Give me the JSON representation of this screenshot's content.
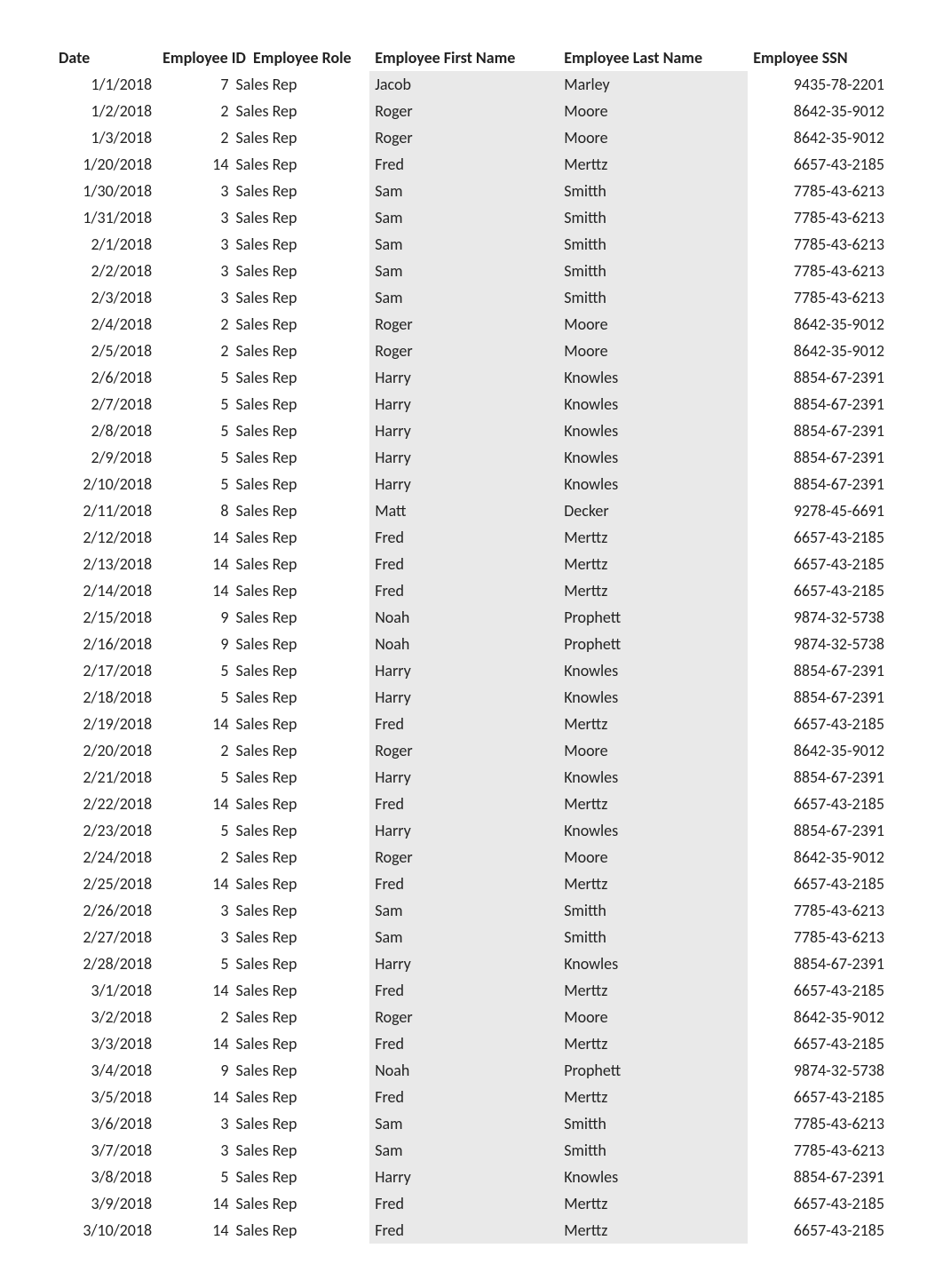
{
  "headers": {
    "date": "Date",
    "employee_id": "Employee ID",
    "employee_role": "Employee Role",
    "first_name": "Employee First Name",
    "last_name": "Employee Last Name",
    "ssn": "Employee SSN"
  },
  "rows": [
    {
      "date": "1/1/2018",
      "id": "7",
      "role": "Sales Rep",
      "first": "Jacob",
      "last": "Marley",
      "ssn": "9435-78-2201"
    },
    {
      "date": "1/2/2018",
      "id": "2",
      "role": "Sales Rep",
      "first": "Roger",
      "last": "Moore",
      "ssn": "8642-35-9012"
    },
    {
      "date": "1/3/2018",
      "id": "2",
      "role": "Sales Rep",
      "first": "Roger",
      "last": "Moore",
      "ssn": "8642-35-9012"
    },
    {
      "date": "1/20/2018",
      "id": "14",
      "role": "Sales Rep",
      "first": "Fred",
      "last": "Merttz",
      "ssn": "6657-43-2185"
    },
    {
      "date": "1/30/2018",
      "id": "3",
      "role": "Sales Rep",
      "first": "Sam",
      "last": "Smitth",
      "ssn": "7785-43-6213"
    },
    {
      "date": "1/31/2018",
      "id": "3",
      "role": "Sales Rep",
      "first": "Sam",
      "last": "Smitth",
      "ssn": "7785-43-6213"
    },
    {
      "date": "2/1/2018",
      "id": "3",
      "role": "Sales Rep",
      "first": "Sam",
      "last": "Smitth",
      "ssn": "7785-43-6213"
    },
    {
      "date": "2/2/2018",
      "id": "3",
      "role": "Sales Rep",
      "first": "Sam",
      "last": "Smitth",
      "ssn": "7785-43-6213"
    },
    {
      "date": "2/3/2018",
      "id": "3",
      "role": "Sales Rep",
      "first": "Sam",
      "last": "Smitth",
      "ssn": "7785-43-6213"
    },
    {
      "date": "2/4/2018",
      "id": "2",
      "role": "Sales Rep",
      "first": "Roger",
      "last": "Moore",
      "ssn": "8642-35-9012"
    },
    {
      "date": "2/5/2018",
      "id": "2",
      "role": "Sales Rep",
      "first": "Roger",
      "last": "Moore",
      "ssn": "8642-35-9012"
    },
    {
      "date": "2/6/2018",
      "id": "5",
      "role": "Sales Rep",
      "first": "Harry",
      "last": "Knowles",
      "ssn": "8854-67-2391"
    },
    {
      "date": "2/7/2018",
      "id": "5",
      "role": "Sales Rep",
      "first": "Harry",
      "last": "Knowles",
      "ssn": "8854-67-2391"
    },
    {
      "date": "2/8/2018",
      "id": "5",
      "role": "Sales Rep",
      "first": "Harry",
      "last": "Knowles",
      "ssn": "8854-67-2391"
    },
    {
      "date": "2/9/2018",
      "id": "5",
      "role": "Sales Rep",
      "first": "Harry",
      "last": "Knowles",
      "ssn": "8854-67-2391"
    },
    {
      "date": "2/10/2018",
      "id": "5",
      "role": "Sales Rep",
      "first": "Harry",
      "last": "Knowles",
      "ssn": "8854-67-2391"
    },
    {
      "date": "2/11/2018",
      "id": "8",
      "role": "Sales Rep",
      "first": "Matt",
      "last": "Decker",
      "ssn": "9278-45-6691"
    },
    {
      "date": "2/12/2018",
      "id": "14",
      "role": "Sales Rep",
      "first": "Fred",
      "last": "Merttz",
      "ssn": "6657-43-2185"
    },
    {
      "date": "2/13/2018",
      "id": "14",
      "role": "Sales Rep",
      "first": "Fred",
      "last": "Merttz",
      "ssn": "6657-43-2185"
    },
    {
      "date": "2/14/2018",
      "id": "14",
      "role": "Sales Rep",
      "first": "Fred",
      "last": "Merttz",
      "ssn": "6657-43-2185"
    },
    {
      "date": "2/15/2018",
      "id": "9",
      "role": "Sales Rep",
      "first": "Noah",
      "last": "Prophett",
      "ssn": "9874-32-5738"
    },
    {
      "date": "2/16/2018",
      "id": "9",
      "role": "Sales Rep",
      "first": "Noah",
      "last": "Prophett",
      "ssn": "9874-32-5738"
    },
    {
      "date": "2/17/2018",
      "id": "5",
      "role": "Sales Rep",
      "first": "Harry",
      "last": "Knowles",
      "ssn": "8854-67-2391"
    },
    {
      "date": "2/18/2018",
      "id": "5",
      "role": "Sales Rep",
      "first": "Harry",
      "last": "Knowles",
      "ssn": "8854-67-2391"
    },
    {
      "date": "2/19/2018",
      "id": "14",
      "role": "Sales Rep",
      "first": "Fred",
      "last": "Merttz",
      "ssn": "6657-43-2185"
    },
    {
      "date": "2/20/2018",
      "id": "2",
      "role": "Sales Rep",
      "first": "Roger",
      "last": "Moore",
      "ssn": "8642-35-9012"
    },
    {
      "date": "2/21/2018",
      "id": "5",
      "role": "Sales Rep",
      "first": "Harry",
      "last": "Knowles",
      "ssn": "8854-67-2391"
    },
    {
      "date": "2/22/2018",
      "id": "14",
      "role": "Sales Rep",
      "first": "Fred",
      "last": "Merttz",
      "ssn": "6657-43-2185"
    },
    {
      "date": "2/23/2018",
      "id": "5",
      "role": "Sales Rep",
      "first": "Harry",
      "last": "Knowles",
      "ssn": "8854-67-2391"
    },
    {
      "date": "2/24/2018",
      "id": "2",
      "role": "Sales Rep",
      "first": "Roger",
      "last": "Moore",
      "ssn": "8642-35-9012"
    },
    {
      "date": "2/25/2018",
      "id": "14",
      "role": "Sales Rep",
      "first": "Fred",
      "last": "Merttz",
      "ssn": "6657-43-2185"
    },
    {
      "date": "2/26/2018",
      "id": "3",
      "role": "Sales Rep",
      "first": "Sam",
      "last": "Smitth",
      "ssn": "7785-43-6213"
    },
    {
      "date": "2/27/2018",
      "id": "3",
      "role": "Sales Rep",
      "first": "Sam",
      "last": "Smitth",
      "ssn": "7785-43-6213"
    },
    {
      "date": "2/28/2018",
      "id": "5",
      "role": "Sales Rep",
      "first": "Harry",
      "last": "Knowles",
      "ssn": "8854-67-2391"
    },
    {
      "date": "3/1/2018",
      "id": "14",
      "role": "Sales Rep",
      "first": "Fred",
      "last": "Merttz",
      "ssn": "6657-43-2185"
    },
    {
      "date": "3/2/2018",
      "id": "2",
      "role": "Sales Rep",
      "first": "Roger",
      "last": "Moore",
      "ssn": "8642-35-9012"
    },
    {
      "date": "3/3/2018",
      "id": "14",
      "role": "Sales Rep",
      "first": "Fred",
      "last": "Merttz",
      "ssn": "6657-43-2185"
    },
    {
      "date": "3/4/2018",
      "id": "9",
      "role": "Sales Rep",
      "first": "Noah",
      "last": "Prophett",
      "ssn": "9874-32-5738"
    },
    {
      "date": "3/5/2018",
      "id": "14",
      "role": "Sales Rep",
      "first": "Fred",
      "last": "Merttz",
      "ssn": "6657-43-2185"
    },
    {
      "date": "3/6/2018",
      "id": "3",
      "role": "Sales Rep",
      "first": "Sam",
      "last": "Smitth",
      "ssn": "7785-43-6213"
    },
    {
      "date": "3/7/2018",
      "id": "3",
      "role": "Sales Rep",
      "first": "Sam",
      "last": "Smitth",
      "ssn": "7785-43-6213"
    },
    {
      "date": "3/8/2018",
      "id": "5",
      "role": "Sales Rep",
      "first": "Harry",
      "last": "Knowles",
      "ssn": "8854-67-2391"
    },
    {
      "date": "3/9/2018",
      "id": "14",
      "role": "Sales Rep",
      "first": "Fred",
      "last": "Merttz",
      "ssn": "6657-43-2185"
    },
    {
      "date": "3/10/2018",
      "id": "14",
      "role": "Sales Rep",
      "first": "Fred",
      "last": "Merttz",
      "ssn": "6657-43-2185"
    }
  ]
}
